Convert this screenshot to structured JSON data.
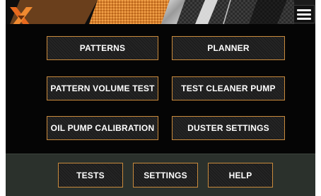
{
  "header": {
    "logo": "x-logo-icon",
    "menu_icon": "hamburger-menu-icon"
  },
  "main_buttons": {
    "patterns": "PATTERNS",
    "planner": "PLANNER",
    "pattern_volume_test": "PATTERN VOLUME TEST",
    "test_cleaner_pump": "TEST CLEANER PUMP",
    "oil_pump_calibration": "OIL PUMP CALIBRATION",
    "duster_settings": "DUSTER SETTINGS"
  },
  "bottom_buttons": {
    "tests": "TESTS",
    "settings": "SETTINGS",
    "help": "HELP"
  },
  "colors": {
    "accent_border": "#c98a3c",
    "background": "#050505",
    "bottom_bar": "#2b312c",
    "logo_orange": "#e86a1e"
  }
}
